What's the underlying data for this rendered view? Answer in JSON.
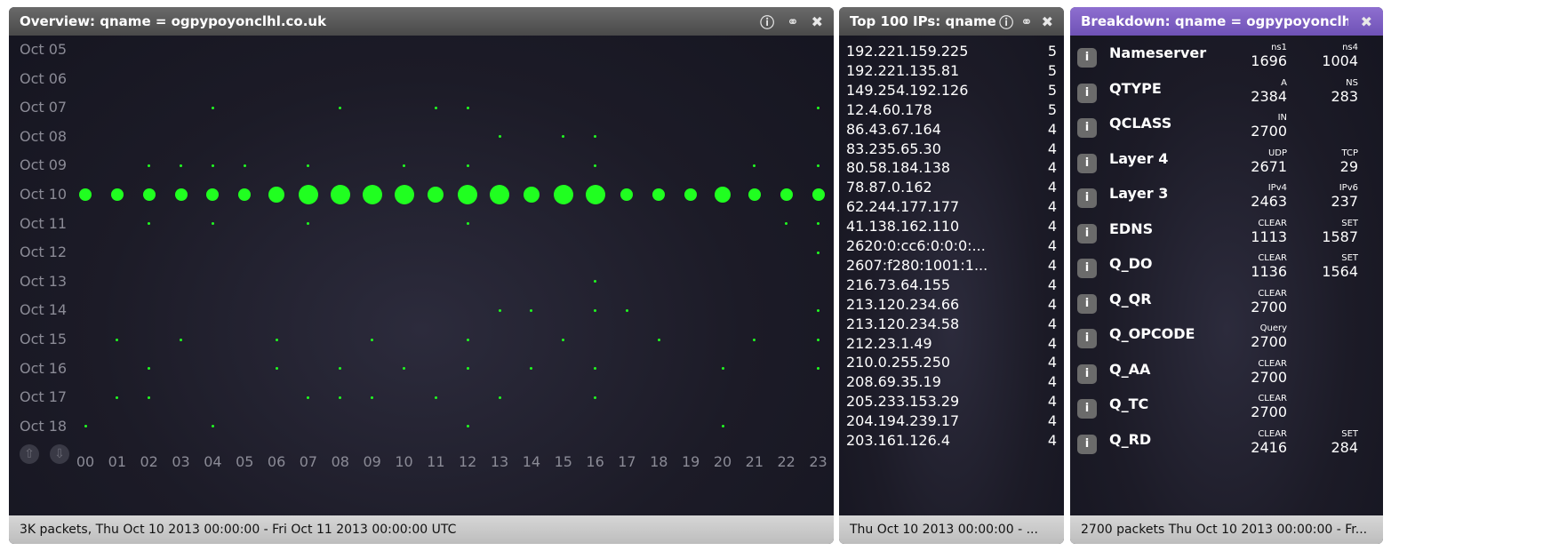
{
  "overview": {
    "title": "Overview: qname = ogpypoyonclhl.co.uk",
    "footer": "3K packets, Thu Oct 10 2013 00:00:00 - Fri Oct 11 2013 00:00:00 UTC",
    "rows": [
      "Oct 05",
      "Oct 06",
      "Oct 07",
      "Oct 08",
      "Oct 09",
      "Oct 10",
      "Oct 11",
      "Oct 12",
      "Oct 13",
      "Oct 14",
      "Oct 15",
      "Oct 16",
      "Oct 17",
      "Oct 18"
    ],
    "cols": [
      "00",
      "01",
      "02",
      "03",
      "04",
      "05",
      "06",
      "07",
      "08",
      "09",
      "10",
      "11",
      "12",
      "13",
      "14",
      "15",
      "16",
      "17",
      "18",
      "19",
      "20",
      "21",
      "22",
      "23"
    ],
    "dot_color": "#20ff20",
    "big_row": "Oct 10",
    "big_sizes": [
      1,
      1,
      1,
      1,
      1,
      1,
      2,
      3,
      3,
      3,
      3,
      2,
      3,
      3,
      2,
      3,
      3,
      1,
      1,
      1,
      2,
      1,
      1,
      1
    ],
    "small_dots": [
      [
        "Oct 07",
        4
      ],
      [
        "Oct 07",
        8
      ],
      [
        "Oct 07",
        11
      ],
      [
        "Oct 07",
        12
      ],
      [
        "Oct 07",
        23
      ],
      [
        "Oct 08",
        13
      ],
      [
        "Oct 08",
        15
      ],
      [
        "Oct 08",
        16
      ],
      [
        "Oct 09",
        2
      ],
      [
        "Oct 09",
        3
      ],
      [
        "Oct 09",
        4
      ],
      [
        "Oct 09",
        5
      ],
      [
        "Oct 09",
        7
      ],
      [
        "Oct 09",
        10
      ],
      [
        "Oct 09",
        12
      ],
      [
        "Oct 09",
        16
      ],
      [
        "Oct 09",
        21
      ],
      [
        "Oct 09",
        23
      ],
      [
        "Oct 11",
        2
      ],
      [
        "Oct 11",
        4
      ],
      [
        "Oct 11",
        7
      ],
      [
        "Oct 11",
        12
      ],
      [
        "Oct 11",
        22
      ],
      [
        "Oct 11",
        23
      ],
      [
        "Oct 12",
        23
      ],
      [
        "Oct 13",
        16
      ],
      [
        "Oct 14",
        13
      ],
      [
        "Oct 14",
        14
      ],
      [
        "Oct 14",
        16
      ],
      [
        "Oct 14",
        17
      ],
      [
        "Oct 14",
        23
      ],
      [
        "Oct 15",
        1
      ],
      [
        "Oct 15",
        3
      ],
      [
        "Oct 15",
        6
      ],
      [
        "Oct 15",
        9
      ],
      [
        "Oct 15",
        12
      ],
      [
        "Oct 15",
        15
      ],
      [
        "Oct 15",
        18
      ],
      [
        "Oct 15",
        21
      ],
      [
        "Oct 15",
        23
      ],
      [
        "Oct 16",
        2
      ],
      [
        "Oct 16",
        6
      ],
      [
        "Oct 16",
        8
      ],
      [
        "Oct 16",
        10
      ],
      [
        "Oct 16",
        12
      ],
      [
        "Oct 16",
        14
      ],
      [
        "Oct 16",
        16
      ],
      [
        "Oct 16",
        20
      ],
      [
        "Oct 16",
        23
      ],
      [
        "Oct 17",
        1
      ],
      [
        "Oct 17",
        2
      ],
      [
        "Oct 17",
        7
      ],
      [
        "Oct 17",
        8
      ],
      [
        "Oct 17",
        9
      ],
      [
        "Oct 17",
        11
      ],
      [
        "Oct 17",
        13
      ],
      [
        "Oct 17",
        16
      ],
      [
        "Oct 18",
        0
      ],
      [
        "Oct 18",
        4
      ],
      [
        "Oct 18",
        12
      ],
      [
        "Oct 18",
        20
      ]
    ]
  },
  "top_ips": {
    "title": "Top 100 IPs: qname",
    "footer": "Thu Oct 10 2013 00:00:00 - ...",
    "items": [
      {
        "ip": "192.221.159.225",
        "count": "5"
      },
      {
        "ip": "192.221.135.81",
        "count": "5"
      },
      {
        "ip": "149.254.192.126",
        "count": "5"
      },
      {
        "ip": "12.4.60.178",
        "count": "5"
      },
      {
        "ip": "86.43.67.164",
        "count": "4"
      },
      {
        "ip": "83.235.65.30",
        "count": "4"
      },
      {
        "ip": "80.58.184.138",
        "count": "4"
      },
      {
        "ip": "78.87.0.162",
        "count": "4"
      },
      {
        "ip": "62.244.177.177",
        "count": "4"
      },
      {
        "ip": "41.138.162.110",
        "count": "4"
      },
      {
        "ip": "2620:0:cc6:0:0:0:...",
        "count": "4"
      },
      {
        "ip": "2607:f280:1001:1...",
        "count": "4"
      },
      {
        "ip": "216.73.64.155",
        "count": "4"
      },
      {
        "ip": "213.120.234.66",
        "count": "4"
      },
      {
        "ip": "213.120.234.58",
        "count": "4"
      },
      {
        "ip": "212.23.1.49",
        "count": "4"
      },
      {
        "ip": "210.0.255.250",
        "count": "4"
      },
      {
        "ip": "208.69.35.19",
        "count": "4"
      },
      {
        "ip": "205.233.153.29",
        "count": "4"
      },
      {
        "ip": "204.194.239.17",
        "count": "4"
      },
      {
        "ip": "203.161.126.4",
        "count": "4"
      }
    ]
  },
  "breakdown": {
    "title": "Breakdown: qname = ogpypoyonclh...",
    "footer": "2700 packets Thu Oct 10 2013 00:00:00 - Fr...",
    "rows": [
      {
        "name": "Nameserver",
        "vals": [
          {
            "k": "ns1",
            "v": "1696"
          },
          {
            "k": "ns4",
            "v": "1004"
          }
        ]
      },
      {
        "name": "QTYPE",
        "vals": [
          {
            "k": "A",
            "v": "2384"
          },
          {
            "k": "NS",
            "v": "283"
          }
        ]
      },
      {
        "name": "QCLASS",
        "vals": [
          {
            "k": "IN",
            "v": "2700"
          }
        ]
      },
      {
        "name": "Layer 4",
        "vals": [
          {
            "k": "UDP",
            "v": "2671"
          },
          {
            "k": "TCP",
            "v": "29"
          }
        ]
      },
      {
        "name": "Layer 3",
        "vals": [
          {
            "k": "IPv4",
            "v": "2463"
          },
          {
            "k": "IPv6",
            "v": "237"
          }
        ]
      },
      {
        "name": "EDNS",
        "vals": [
          {
            "k": "CLEAR",
            "v": "1113"
          },
          {
            "k": "SET",
            "v": "1587"
          }
        ]
      },
      {
        "name": "Q_DO",
        "vals": [
          {
            "k": "CLEAR",
            "v": "1136"
          },
          {
            "k": "SET",
            "v": "1564"
          }
        ]
      },
      {
        "name": "Q_QR",
        "vals": [
          {
            "k": "CLEAR",
            "v": "2700"
          }
        ]
      },
      {
        "name": "Q_OPCODE",
        "vals": [
          {
            "k": "Query",
            "v": "2700"
          }
        ]
      },
      {
        "name": "Q_AA",
        "vals": [
          {
            "k": "CLEAR",
            "v": "2700"
          }
        ]
      },
      {
        "name": "Q_TC",
        "vals": [
          {
            "k": "CLEAR",
            "v": "2700"
          }
        ]
      },
      {
        "name": "Q_RD",
        "vals": [
          {
            "k": "CLEAR",
            "v": "2416"
          },
          {
            "k": "SET",
            "v": "284"
          }
        ]
      }
    ]
  }
}
